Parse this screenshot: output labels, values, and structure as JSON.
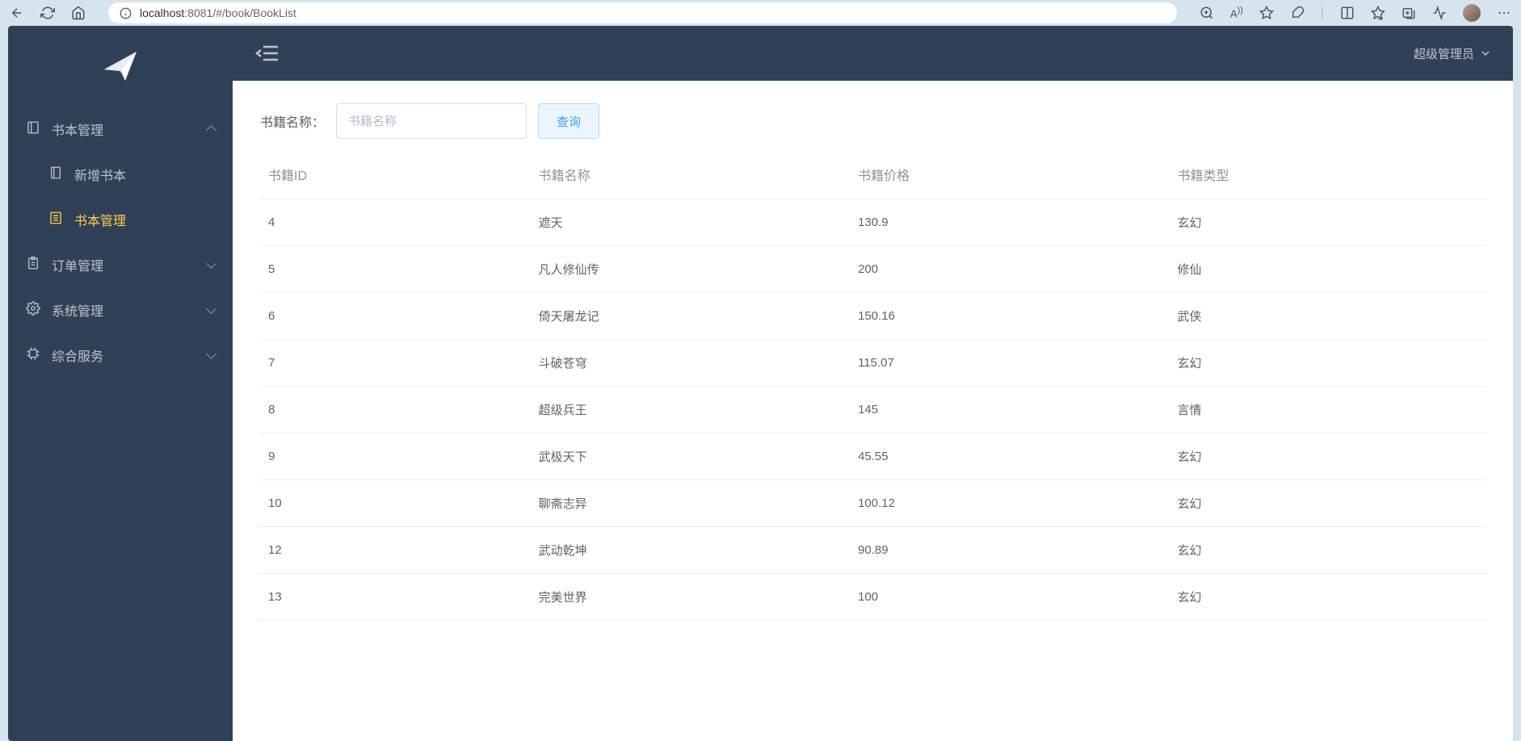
{
  "browser": {
    "url_host": "localhost",
    "url_port": ":8081",
    "url_path": "/#/book/BookList"
  },
  "sidebar": {
    "items": [
      {
        "label": "书本管理",
        "icon": "book-icon",
        "expanded": true,
        "children": [
          {
            "label": "新增书本",
            "icon": "add-doc-icon",
            "active": false
          },
          {
            "label": "书本管理",
            "icon": "list-doc-icon",
            "active": true
          }
        ]
      },
      {
        "label": "订单管理",
        "icon": "clipboard-icon",
        "expanded": false
      },
      {
        "label": "系统管理",
        "icon": "gear-icon",
        "expanded": false
      },
      {
        "label": "综合服务",
        "icon": "chip-icon",
        "expanded": false
      }
    ]
  },
  "topbar": {
    "user_label": "超级管理员"
  },
  "search": {
    "label": "书籍名称：",
    "placeholder": "书籍名称",
    "button_label": "查询"
  },
  "table": {
    "headers": {
      "id": "书籍ID",
      "name": "书籍名称",
      "price": "书籍价格",
      "type": "书籍类型"
    },
    "rows": [
      {
        "id": "4",
        "name": "遮天",
        "price": "130.9",
        "type": "玄幻"
      },
      {
        "id": "5",
        "name": "凡人修仙传",
        "price": "200",
        "type": "修仙"
      },
      {
        "id": "6",
        "name": "倚天屠龙记",
        "price": "150.16",
        "type": "武侠"
      },
      {
        "id": "7",
        "name": "斗破苍穹",
        "price": "115.07",
        "type": "玄幻"
      },
      {
        "id": "8",
        "name": "超级兵王",
        "price": "145",
        "type": "言情"
      },
      {
        "id": "9",
        "name": "武极天下",
        "price": "45.55",
        "type": "玄幻"
      },
      {
        "id": "10",
        "name": "聊斋志异",
        "price": "100.12",
        "type": "玄幻"
      },
      {
        "id": "12",
        "name": "武动乾坤",
        "price": "90.89",
        "type": "玄幻"
      },
      {
        "id": "13",
        "name": "完美世界",
        "price": "100",
        "type": "玄幻"
      }
    ]
  }
}
